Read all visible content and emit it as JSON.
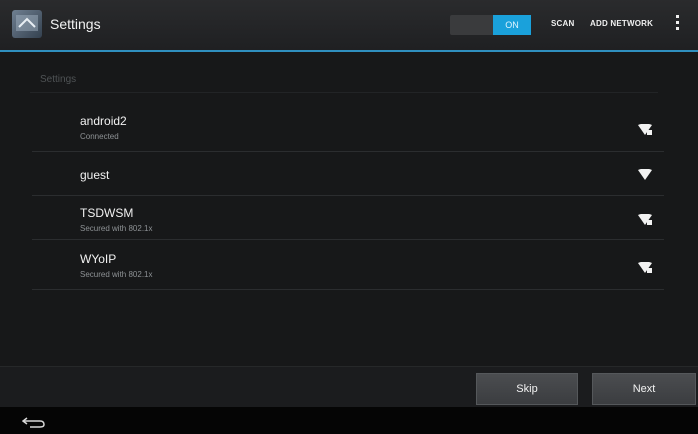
{
  "action_bar": {
    "title": "Settings",
    "wifi_toggle": {
      "state": "ON"
    },
    "scan_label": "SCAN",
    "add_network_label": "ADD NETWORK",
    "overflow_icon": "overflow-menu-icon",
    "app_icon": "settings-app-icon"
  },
  "content": {
    "section_header": "Settings",
    "networks": [
      {
        "name": "android2",
        "status": "Connected",
        "icon": "wifi-signal-icon"
      },
      {
        "name": "guest",
        "status": "",
        "icon": "wifi-signal-icon"
      },
      {
        "name": "TSDWSM",
        "status": "Secured with 802.1x",
        "icon": "wifi-signal-locked-icon"
      },
      {
        "name": "WYoIP",
        "status": "Secured with 802.1x",
        "icon": "wifi-signal-locked-icon"
      }
    ]
  },
  "buttons": {
    "skip_label": "Skip",
    "next_label": "Next"
  },
  "nav": {
    "back_icon": "back-icon"
  },
  "colors": {
    "accent": "#1aa1db",
    "action_bar_rule": "#2f8fbf",
    "background": "#171819"
  }
}
